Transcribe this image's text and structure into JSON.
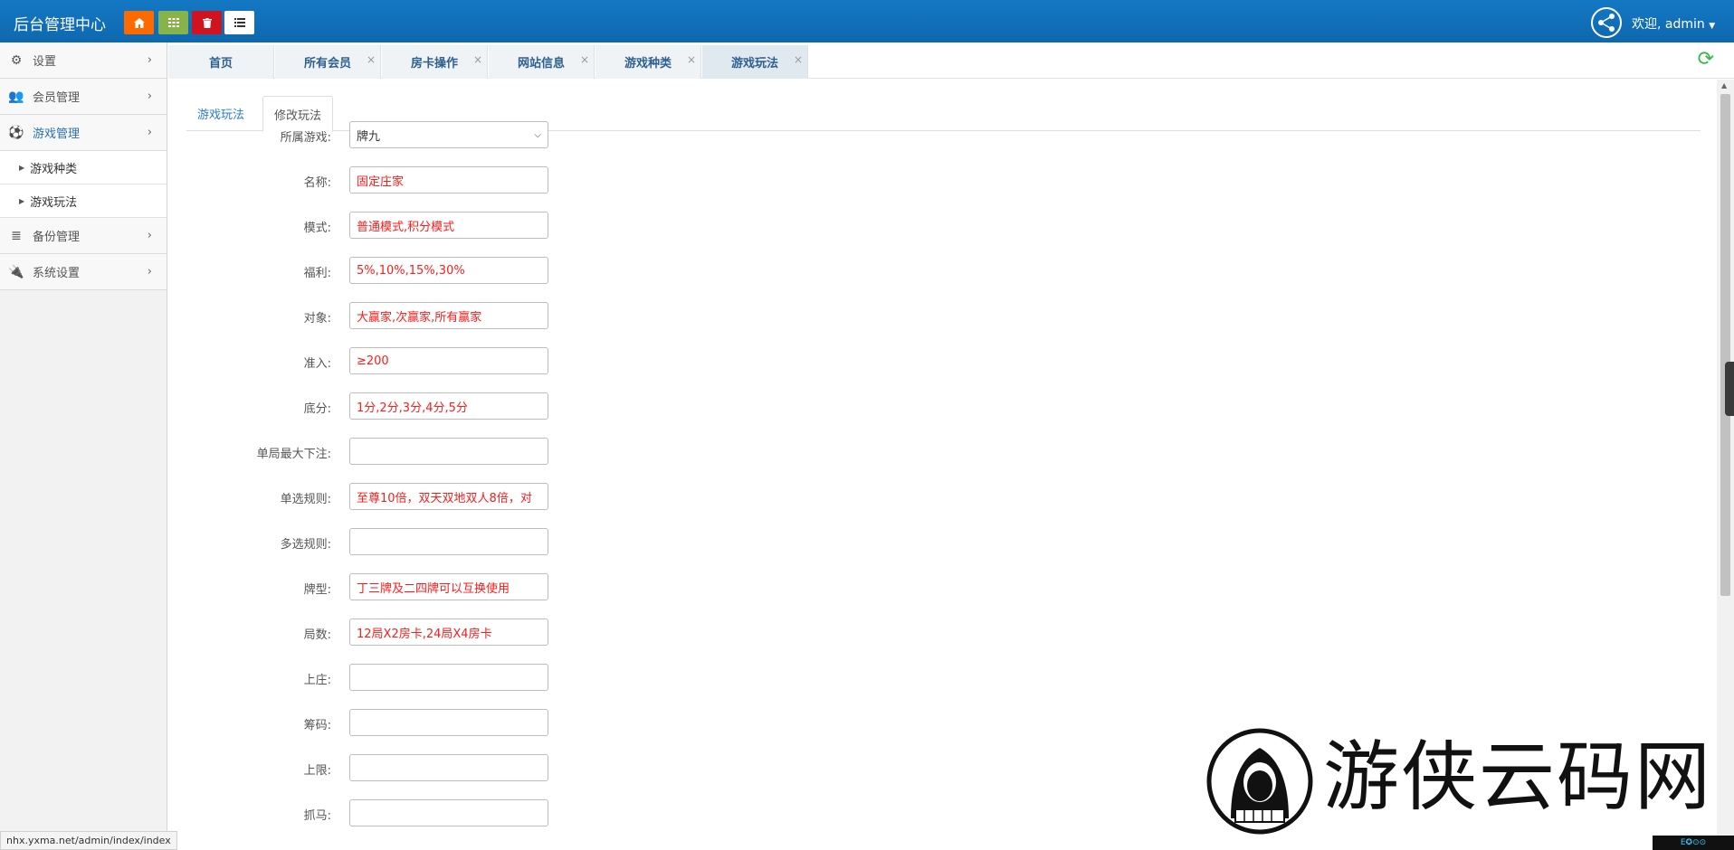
{
  "header": {
    "brand": "后台管理中心",
    "toolbar_icons": [
      "home-icon",
      "grid-icon",
      "trash-icon",
      "list-icon"
    ],
    "welcome": "欢迎, admin",
    "colors": {
      "bar": "#1173bd",
      "home": "#ff6a00",
      "grid": "#87b34a",
      "trash": "#d0131e"
    }
  },
  "sidebar": {
    "items": [
      {
        "label": "设置",
        "icon": "gears-icon"
      },
      {
        "label": "会员管理",
        "icon": "users-icon"
      },
      {
        "label": "游戏管理",
        "icon": "soccer-ball-icon",
        "active": true
      },
      {
        "label": "备份管理",
        "icon": "database-icon"
      },
      {
        "label": "系统设置",
        "icon": "plug-icon"
      }
    ],
    "subitems": [
      {
        "label": "游戏种类"
      },
      {
        "label": "游戏玩法"
      }
    ]
  },
  "page_tabs": [
    {
      "label": "首页",
      "closable": false
    },
    {
      "label": "所有会员",
      "closable": true
    },
    {
      "label": "房卡操作",
      "closable": true
    },
    {
      "label": "网站信息",
      "closable": true
    },
    {
      "label": "游戏种类",
      "closable": true
    },
    {
      "label": "游戏玩法",
      "closable": true,
      "active": true
    }
  ],
  "inner_tabs": [
    {
      "label": "游戏玩法"
    },
    {
      "label": "修改玩法",
      "active": true
    }
  ],
  "form": {
    "game_label": "所属游戏:",
    "game_value": "牌九",
    "fields": [
      {
        "label": "名称:",
        "value": "固定庄家"
      },
      {
        "label": "模式:",
        "value": "普通模式,积分模式"
      },
      {
        "label": "福利:",
        "value": "5%,10%,15%,30%"
      },
      {
        "label": "对象:",
        "value": "大赢家,次赢家,所有赢家"
      },
      {
        "label": "准入:",
        "value": "≥200"
      },
      {
        "label": "底分:",
        "value": "1分,2分,3分,4分,5分"
      },
      {
        "label": "单局最大下注:",
        "value": ""
      },
      {
        "label": "单选规则:",
        "value": "至尊10倍，双天双地双人8倍，对"
      },
      {
        "label": "多选规则:",
        "value": ""
      },
      {
        "label": "牌型:",
        "value": "丁三牌及二四牌可以互换使用"
      },
      {
        "label": "局数:",
        "value": "12局X2房卡,24局X4房卡"
      },
      {
        "label": "上庄:",
        "value": ""
      },
      {
        "label": "筹码:",
        "value": ""
      },
      {
        "label": "上限:",
        "value": ""
      },
      {
        "label": "抓马:",
        "value": ""
      }
    ]
  },
  "status_url": "nhx.yxma.net/admin/index/index",
  "watermark": {
    "text": "游侠云码网"
  },
  "badge_text": "E✪⊙⊙"
}
